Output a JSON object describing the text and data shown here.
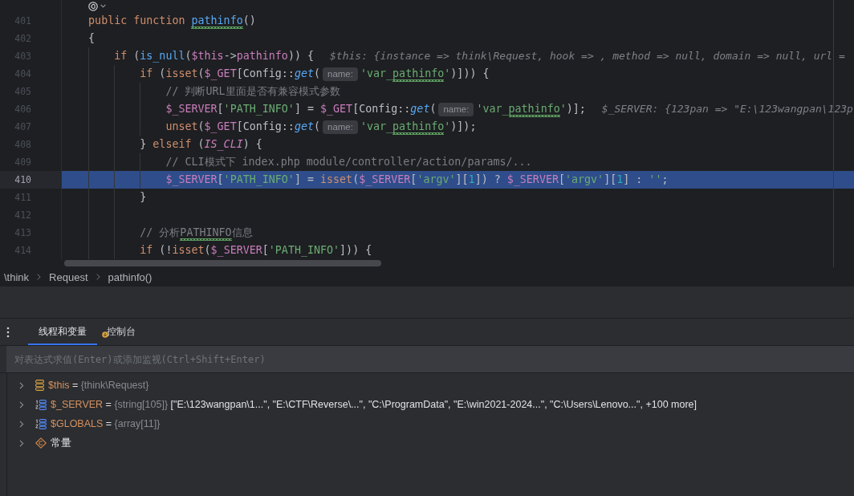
{
  "editor": {
    "lines": [
      {
        "number": "401",
        "current": false,
        "segments": [
          {
            "kind": "code",
            "tokens": [
              {
                "text": "    public function ",
                "kind": "keyword",
                "typo": false
              },
              {
                "text": "pathinfo",
                "kind": "function",
                "typo": true
              },
              {
                "text": "()",
                "kind": "plain",
                "typo": false
              }
            ]
          }
        ]
      },
      {
        "number": "402",
        "current": false,
        "segments": [
          {
            "kind": "code",
            "tokens": [
              {
                "text": "    {",
                "kind": "plain",
                "typo": false
              }
            ]
          }
        ]
      },
      {
        "number": "403",
        "current": false,
        "segments": [
          {
            "kind": "code",
            "tokens": [
              {
                "text": "        if ",
                "kind": "keyword",
                "typo": false
              },
              {
                "text": "(",
                "kind": "plain",
                "typo": false
              },
              {
                "text": "is_null",
                "kind": "function",
                "typo": false
              },
              {
                "text": "(",
                "kind": "plain",
                "typo": false
              },
              {
                "text": "$this",
                "kind": "variable",
                "typo": false
              },
              {
                "text": "->",
                "kind": "plain",
                "typo": false
              },
              {
                "text": "pathinfo",
                "kind": "property",
                "typo": false
              },
              {
                "text": ")) {",
                "kind": "plain",
                "typo": false
              }
            ]
          },
          {
            "kind": "value",
            "text": "$this: {instance => think\\Request, hook => , method => null, domain => null, url ="
          }
        ]
      },
      {
        "number": "404",
        "current": false,
        "segments": [
          {
            "kind": "code",
            "tokens": [
              {
                "text": "            if ",
                "kind": "keyword",
                "typo": false
              },
              {
                "text": "(",
                "kind": "plain",
                "typo": false
              },
              {
                "text": "isset",
                "kind": "keyword",
                "typo": false
              },
              {
                "text": "(",
                "kind": "plain",
                "typo": false
              },
              {
                "text": "$_GET",
                "kind": "variable",
                "typo": false
              },
              {
                "text": "[Config::",
                "kind": "plain",
                "typo": false
              },
              {
                "text": "get",
                "kind": "static",
                "typo": false
              },
              {
                "text": "(",
                "kind": "plain",
                "typo": false
              }
            ]
          },
          {
            "kind": "hint",
            "text": "name:"
          },
          {
            "kind": "code",
            "tokens": [
              {
                "text": "'var_",
                "kind": "string",
                "typo": false
              },
              {
                "text": "pathinfo",
                "kind": "string",
                "typo": true
              },
              {
                "text": "'",
                "kind": "string",
                "typo": false
              },
              {
                "text": ")])) {",
                "kind": "plain",
                "typo": false
              }
            ]
          }
        ]
      },
      {
        "number": "405",
        "current": false,
        "segments": [
          {
            "kind": "code",
            "tokens": [
              {
                "text": "                // 判断URL里面是否有兼容模式参数",
                "kind": "comment",
                "typo": false
              }
            ]
          }
        ]
      },
      {
        "number": "406",
        "current": false,
        "segments": [
          {
            "kind": "code",
            "tokens": [
              {
                "text": "                $_SERVER",
                "kind": "variable",
                "typo": false
              },
              {
                "text": "[",
                "kind": "plain",
                "typo": false
              },
              {
                "text": "'PATH_INFO'",
                "kind": "string",
                "typo": false
              },
              {
                "text": "] = ",
                "kind": "plain",
                "typo": false
              },
              {
                "text": "$_GET",
                "kind": "variable",
                "typo": false
              },
              {
                "text": "[Config::",
                "kind": "plain",
                "typo": false
              },
              {
                "text": "get",
                "kind": "static",
                "typo": false
              },
              {
                "text": "(",
                "kind": "plain",
                "typo": false
              }
            ]
          },
          {
            "kind": "hint",
            "text": "name:"
          },
          {
            "kind": "code",
            "tokens": [
              {
                "text": "'var_",
                "kind": "string",
                "typo": false
              },
              {
                "text": "pathinfo",
                "kind": "string",
                "typo": true
              },
              {
                "text": "'",
                "kind": "string",
                "typo": false
              },
              {
                "text": ")];",
                "kind": "plain",
                "typo": false
              }
            ]
          },
          {
            "kind": "value",
            "text": "$_SERVER: {123pan => \"E:\\123wangpan\\123p"
          }
        ]
      },
      {
        "number": "407",
        "current": false,
        "segments": [
          {
            "kind": "code",
            "tokens": [
              {
                "text": "                unset",
                "kind": "keyword",
                "typo": false
              },
              {
                "text": "(",
                "kind": "plain",
                "typo": false
              },
              {
                "text": "$_GET",
                "kind": "variable",
                "typo": false
              },
              {
                "text": "[Config::",
                "kind": "plain",
                "typo": false
              },
              {
                "text": "get",
                "kind": "static",
                "typo": false
              },
              {
                "text": "(",
                "kind": "plain",
                "typo": false
              }
            ]
          },
          {
            "kind": "hint",
            "text": "name:"
          },
          {
            "kind": "code",
            "tokens": [
              {
                "text": "'var_",
                "kind": "string",
                "typo": false
              },
              {
                "text": "pathinfo",
                "kind": "string",
                "typo": true
              },
              {
                "text": "'",
                "kind": "string",
                "typo": false
              },
              {
                "text": ")]);",
                "kind": "plain",
                "typo": false
              }
            ]
          }
        ]
      },
      {
        "number": "408",
        "current": false,
        "segments": [
          {
            "kind": "code",
            "tokens": [
              {
                "text": "            } ",
                "kind": "plain",
                "typo": false
              },
              {
                "text": "elseif ",
                "kind": "keyword",
                "typo": false
              },
              {
                "text": "(",
                "kind": "plain",
                "typo": false
              },
              {
                "text": "IS_CLI",
                "kind": "constant",
                "typo": false
              },
              {
                "text": ") {",
                "kind": "plain",
                "typo": false
              }
            ]
          }
        ]
      },
      {
        "number": "409",
        "current": false,
        "segments": [
          {
            "kind": "code",
            "tokens": [
              {
                "text": "                // CLI模式下 index.php module/controller/action/params/...",
                "kind": "comment",
                "typo": false
              }
            ]
          }
        ]
      },
      {
        "number": "410",
        "current": true,
        "segments": [
          {
            "kind": "code",
            "tokens": [
              {
                "text": "                $_SERVER",
                "kind": "variable",
                "typo": false
              },
              {
                "text": "[",
                "kind": "plain",
                "typo": false
              },
              {
                "text": "'PATH_INFO'",
                "kind": "string",
                "typo": false
              },
              {
                "text": "] = ",
                "kind": "plain",
                "typo": false
              },
              {
                "text": "isset",
                "kind": "keyword",
                "typo": false
              },
              {
                "text": "(",
                "kind": "plain",
                "typo": false
              },
              {
                "text": "$_SERVER",
                "kind": "variable",
                "typo": false
              },
              {
                "text": "[",
                "kind": "plain",
                "typo": false
              },
              {
                "text": "'argv'",
                "kind": "string",
                "typo": false
              },
              {
                "text": "][",
                "kind": "plain",
                "typo": false
              },
              {
                "text": "1",
                "kind": "number",
                "typo": false
              },
              {
                "text": "]) ? ",
                "kind": "plain",
                "typo": false
              },
              {
                "text": "$_SERVER",
                "kind": "variable",
                "typo": false
              },
              {
                "text": "[",
                "kind": "plain",
                "typo": false
              },
              {
                "text": "'argv'",
                "kind": "string",
                "typo": false
              },
              {
                "text": "][",
                "kind": "plain",
                "typo": false
              },
              {
                "text": "1",
                "kind": "number",
                "typo": false
              },
              {
                "text": "] : ",
                "kind": "plain",
                "typo": false
              },
              {
                "text": "''",
                "kind": "string",
                "typo": false
              },
              {
                "text": ";",
                "kind": "plain",
                "typo": false
              }
            ]
          }
        ]
      },
      {
        "number": "411",
        "current": false,
        "segments": [
          {
            "kind": "code",
            "tokens": [
              {
                "text": "            }",
                "kind": "plain",
                "typo": false
              }
            ]
          }
        ]
      },
      {
        "number": "412",
        "current": false
      },
      {
        "number": "413",
        "current": false,
        "segments": [
          {
            "kind": "code",
            "tokens": [
              {
                "text": "            // 分析",
                "kind": "comment",
                "typo": false
              },
              {
                "text": "PATHINFO",
                "kind": "comment",
                "typo": true
              },
              {
                "text": "信息",
                "kind": "comment",
                "typo": false
              }
            ]
          }
        ]
      },
      {
        "number": "414",
        "current": false,
        "segments": [
          {
            "kind": "code",
            "tokens": [
              {
                "text": "            if ",
                "kind": "keyword",
                "typo": false
              },
              {
                "text": "(!",
                "kind": "plain",
                "typo": false
              },
              {
                "text": "isset",
                "kind": "keyword",
                "typo": false
              },
              {
                "text": "(",
                "kind": "plain",
                "typo": false
              },
              {
                "text": "$_SERVER",
                "kind": "variable",
                "typo": false
              },
              {
                "text": "[",
                "kind": "plain",
                "typo": false
              },
              {
                "text": "'PATH_INFO'",
                "kind": "string",
                "typo": false
              },
              {
                "text": "])) {",
                "kind": "plain",
                "typo": false
              }
            ]
          }
        ]
      }
    ]
  },
  "breadcrumb": [
    {
      "label": "\\think"
    },
    {
      "label": "Request"
    },
    {
      "label": "pathinfo()"
    }
  ],
  "debugger": {
    "tabs": [
      {
        "label": "线程和变量",
        "selected": true
      },
      {
        "label": "控制台",
        "selected": false
      }
    ],
    "evaluate_field": {
      "placeholder": "对表达式求值(Enter)或添加监视(Ctrl+Shift+Enter)"
    },
    "variables": [
      {
        "kind": "object",
        "name": "$this",
        "operator": "=",
        "type": "{think\\Request}",
        "expanded": false
      },
      {
        "kind": "array",
        "name": "$_SERVER",
        "operator": "=",
        "type": "{string[105]}",
        "value": "[\"E:\\123wangpan\\1...\", \"E:\\CTF\\Reverse\\...\", \"C:\\ProgramData\", \"E:\\win2021-2024...\", \"C:\\Users\\Lenovo...\", +100 more]",
        "expanded": false
      },
      {
        "kind": "array",
        "name": "$GLOBALS",
        "operator": "=",
        "type": "{array[11]}",
        "expanded": false
      },
      {
        "kind": "constants",
        "name": "常量",
        "expanded": false
      }
    ]
  }
}
